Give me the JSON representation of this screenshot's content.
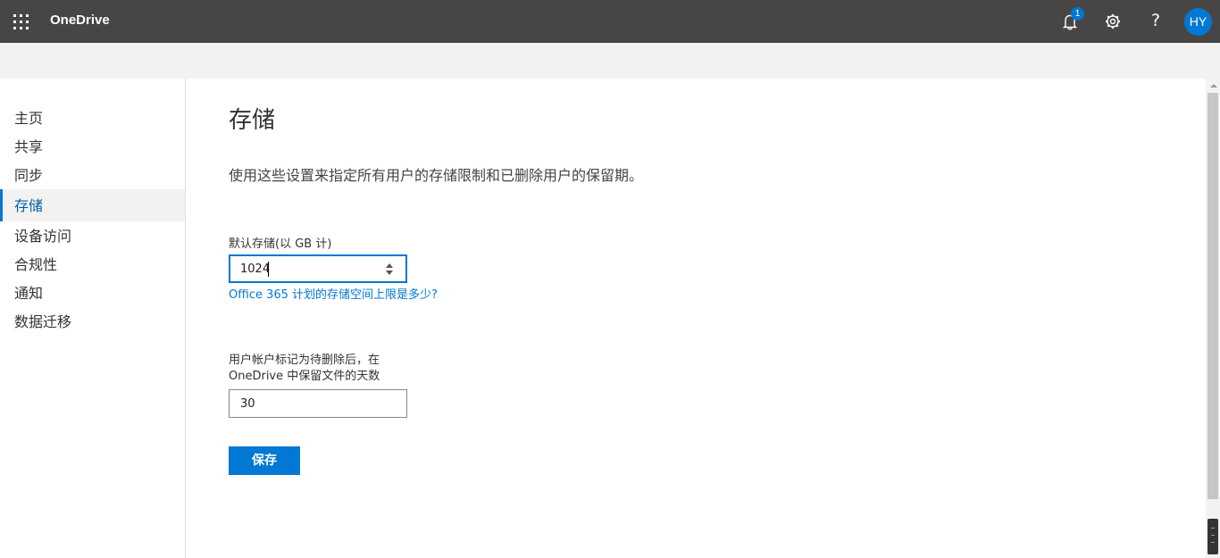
{
  "header": {
    "app_name": "OneDrive",
    "notification_count": "1",
    "help_glyph": "?",
    "avatar_initials": "HY",
    "icons": [
      "app-launcher-icon",
      "bell-icon",
      "gear-icon",
      "help-icon"
    ]
  },
  "sidebar": {
    "items": [
      {
        "label": "主页"
      },
      {
        "label": "共享"
      },
      {
        "label": "同步"
      },
      {
        "label": "存储",
        "active": true
      },
      {
        "label": "设备访问"
      },
      {
        "label": "合规性"
      },
      {
        "label": "通知"
      },
      {
        "label": "数据迁移"
      }
    ]
  },
  "main": {
    "title": "存储",
    "description": "使用这些设置来指定所有用户的存储限制和已删除用户的保留期。",
    "default_storage": {
      "label": "默认存储(以 GB 计)",
      "value": "1024"
    },
    "help_link": "Office 365 计划的存储空间上限是多少?",
    "retention": {
      "label_line1": "用户帐户标记为待删除后，在",
      "label_line2": "OneDrive 中保留文件的天数",
      "value": "30"
    },
    "save_label": "保存"
  },
  "colors": {
    "topbar": "#484644",
    "accent": "#0078d4",
    "subbar": "#f3f2f1"
  }
}
